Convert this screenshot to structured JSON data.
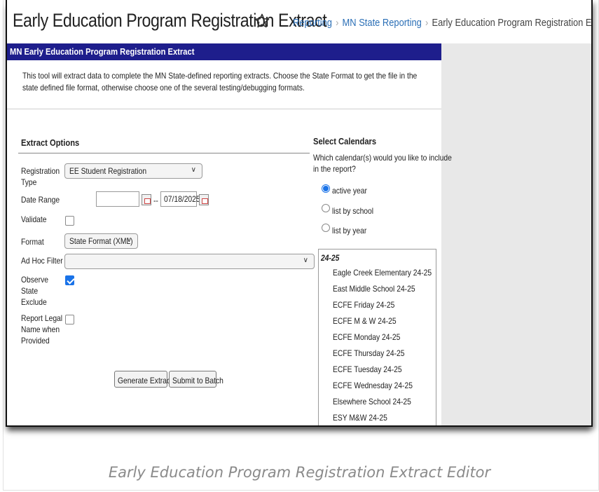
{
  "header": {
    "title": "Early Education Program Registration Extract",
    "breadcrumbs": [
      "Reporting",
      "MN State Reporting",
      "Early Education Program Registration Extract"
    ]
  },
  "panel": {
    "title": "MN Early Education Program Registration Extract",
    "description": "This tool will extract data to complete the MN State-defined reporting extracts. Choose the State Format to get the file in the state defined file format, otherwise choose one of the several testing/debugging formats."
  },
  "extract_options": {
    "section_title": "Extract Options",
    "registration_type": {
      "label_line1": "Registration",
      "label_line2": "Type",
      "value": "EE Student Registration"
    },
    "date_range": {
      "label": "Date Range",
      "start_value": "",
      "separator": "--",
      "end_value": "07/18/2025"
    },
    "validate": {
      "label": "Validate",
      "checked": false
    },
    "format": {
      "label": "Format",
      "value": "State Format (XML)"
    },
    "ad_hoc_filter": {
      "label": "Ad Hoc Filter",
      "value": ""
    },
    "observe_state_exclude": {
      "label_line1": "Observe",
      "label_line2": "State",
      "label_line3": "Exclude",
      "checked": true
    },
    "report_legal_name": {
      "label_line1": "Report Legal",
      "label_line2": "Name when",
      "label_line3": "Provided",
      "checked": false
    }
  },
  "buttons": {
    "generate": "Generate Extract",
    "submit": "Submit to Batch"
  },
  "calendars": {
    "section_title": "Select Calendars",
    "prompt_line1": "Which calendar(s) would you like to include",
    "prompt_line2": "in the report?",
    "options": [
      {
        "label": "active year",
        "selected": true
      },
      {
        "label": "list by school",
        "selected": false
      },
      {
        "label": "list by year",
        "selected": false
      }
    ],
    "group": "24-25",
    "items": [
      "Eagle Creek Elementary 24-25",
      "East Middle School 24-25",
      "ECFE Friday 24-25",
      "ECFE M & W 24-25",
      "ECFE Monday 24-25",
      "ECFE Thursday 24-25",
      "ECFE Tuesday 24-25",
      "ECFE Wednesday 24-25",
      "Elsewhere School 24-25",
      "ESY M&W 24-25"
    ]
  },
  "caption": "Early Education Program Registration Extract Editor",
  "colors": {
    "panel_header": "#1e1e8c",
    "link": "#2b6fb6",
    "accent": "#1a73e8"
  }
}
